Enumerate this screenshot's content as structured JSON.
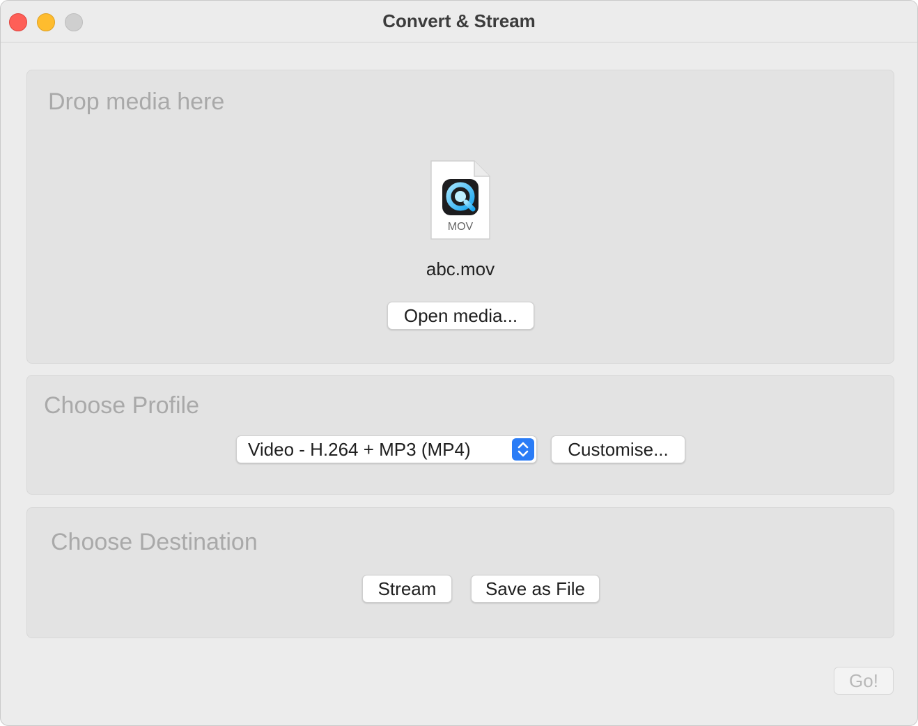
{
  "window": {
    "title": "Convert & Stream"
  },
  "drop_panel": {
    "heading": "Drop media here",
    "file_type_label": "MOV",
    "file_name": "abc.mov",
    "open_button_label": "Open media..."
  },
  "profile_panel": {
    "heading": "Choose Profile",
    "selected_profile": "Video - H.264 + MP3 (MP4)",
    "customise_button_label": "Customise..."
  },
  "destination_panel": {
    "heading": "Choose Destination",
    "stream_button_label": "Stream",
    "save_button_label": "Save as File"
  },
  "footer": {
    "go_button_label": "Go!",
    "go_button_enabled": false
  },
  "colors": {
    "close": "#fe5f57",
    "minimize": "#febc2e",
    "zoom_disabled": "#cfcfcf",
    "accent": "#2a7cf6",
    "panel_heading": "#a9a9a9"
  },
  "icons": {
    "file": "quicktime-mov-file-icon",
    "select_arrows": "chevron-up-down-icon"
  }
}
